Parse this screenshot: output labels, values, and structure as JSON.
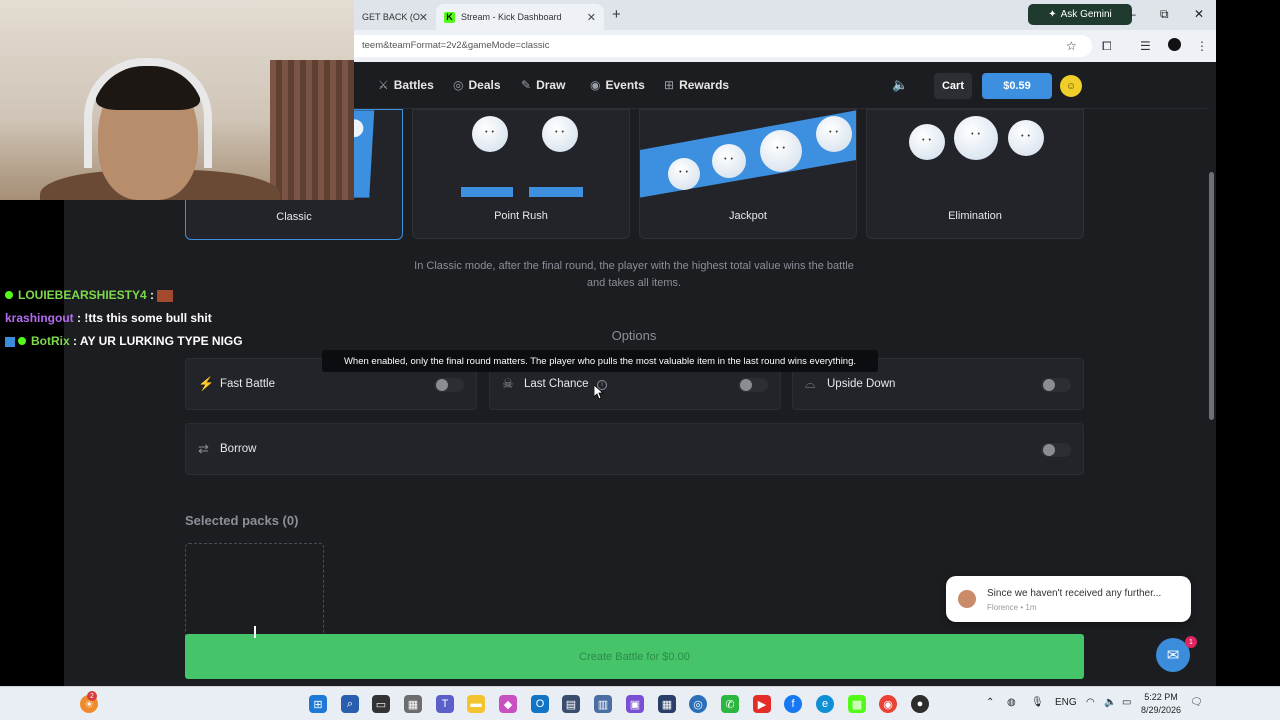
{
  "browser": {
    "tabs": [
      {
        "label": "GET BACK (O"
      },
      {
        "label": "Stream - Kick Dashboard"
      }
    ],
    "new_tab": "+",
    "ask_gemini": "Ask Gemini",
    "url": "teem&teamFormat=2v2&gameMode=classic",
    "window": {
      "minimize": "–",
      "restore": "⧉",
      "close": "✕"
    }
  },
  "nav": {
    "items": [
      {
        "label": "Battles",
        "icon": "crossed-swords-icon"
      },
      {
        "label": "Deals",
        "icon": "deals-icon"
      },
      {
        "label": "Draw",
        "icon": "draw-icon"
      },
      {
        "label": "Events",
        "icon": "events-icon"
      },
      {
        "label": "Rewards",
        "icon": "gift-icon"
      }
    ],
    "cart": "Cart",
    "balance": "$0.59"
  },
  "modes": [
    {
      "label": "Classic",
      "selected": true
    },
    {
      "label": "Point Rush",
      "selected": false
    },
    {
      "label": "Jackpot",
      "selected": false
    },
    {
      "label": "Elimination",
      "selected": false
    }
  ],
  "mode_description": {
    "line1": "In Classic mode, after the final round, the player with the highest total value wins the battle",
    "line2": "and takes all items."
  },
  "options": {
    "title": "Options",
    "tooltip": "When enabled, only the final round matters. The player who pulls the most valuable item in the last round wins everything.",
    "items": [
      {
        "label": "Fast Battle",
        "enabled": false
      },
      {
        "label": "Last Chance",
        "enabled": false
      },
      {
        "label": "Upside Down",
        "enabled": false
      },
      {
        "label": "Borrow",
        "enabled": false
      }
    ]
  },
  "selected_packs": {
    "title": "Selected packs (0)"
  },
  "create_button": "Create Battle for $0.00",
  "notification": {
    "message": "Since we haven't received any further...",
    "sender": "Florence • 1m",
    "badge": "1"
  },
  "chat": [
    {
      "user": "LOUIEBEARSHIESTY4",
      "sep": ":",
      "text": "",
      "user_color": "#7dd94a"
    },
    {
      "user": "krashingout",
      "sep": ":",
      "text": "!tts this some bull shit",
      "user_color": "#b56cf0"
    },
    {
      "user": "BotRix",
      "sep": ":",
      "text": "AY UR LURKING TYPE NIGG",
      "user_color": "#7dd94a"
    }
  ],
  "taskbar": {
    "lang": "ENG",
    "time": "5:22 PM",
    "date": "8/29/2026",
    "notif_badge": "2"
  },
  "colors": {
    "accent": "#3d8fe0",
    "create": "#45c46a",
    "background": "#1c1d21"
  }
}
